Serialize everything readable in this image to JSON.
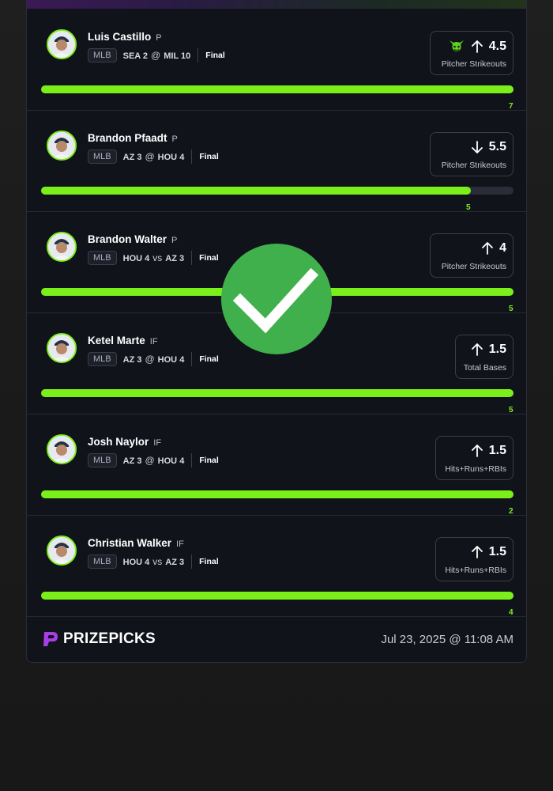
{
  "rows": [
    {
      "name": "Luis Castillo",
      "pos": "P",
      "league": "MLB",
      "team_a": "SEA",
      "score_a": "2",
      "sep": "@",
      "team_b": "MIL",
      "score_b": "10",
      "status": "Final",
      "line": "4.5",
      "direction": "up",
      "stat": "Pitcher Strikeouts",
      "demon": true,
      "actual": "7",
      "progress": 1.0
    },
    {
      "name": "Brandon Pfaadt",
      "pos": "P",
      "league": "MLB",
      "team_a": "AZ",
      "score_a": "3",
      "sep": "@",
      "team_b": "HOU",
      "score_b": "4",
      "status": "Final",
      "line": "5.5",
      "direction": "down",
      "stat": "Pitcher Strikeouts",
      "demon": false,
      "actual": "5",
      "progress": 0.91
    },
    {
      "name": "Brandon Walter",
      "pos": "P",
      "league": "MLB",
      "team_a": "HOU",
      "score_a": "4",
      "sep": "vs",
      "team_b": "AZ",
      "score_b": "3",
      "status": "Final",
      "line": "4",
      "direction": "up",
      "stat": "Pitcher Strikeouts",
      "demon": false,
      "actual": "5",
      "progress": 1.0
    },
    {
      "name": "Ketel Marte",
      "pos": "IF",
      "league": "MLB",
      "team_a": "AZ",
      "score_a": "3",
      "sep": "@",
      "team_b": "HOU",
      "score_b": "4",
      "status": "Final",
      "line": "1.5",
      "direction": "up",
      "stat": "Total Bases",
      "demon": false,
      "actual": "5",
      "progress": 1.0
    },
    {
      "name": "Josh Naylor",
      "pos": "IF",
      "league": "MLB",
      "team_a": "AZ",
      "score_a": "3",
      "sep": "@",
      "team_b": "HOU",
      "score_b": "4",
      "status": "Final",
      "line": "1.5",
      "direction": "up",
      "stat": "Hits+Runs+RBIs",
      "demon": false,
      "actual": "2",
      "progress": 1.0
    },
    {
      "name": "Christian Walker",
      "pos": "IF",
      "league": "MLB",
      "team_a": "HOU",
      "score_a": "4",
      "sep": "vs",
      "team_b": "AZ",
      "score_b": "3",
      "status": "Final",
      "line": "1.5",
      "direction": "up",
      "stat": "Hits+Runs+RBIs",
      "demon": false,
      "actual": "4",
      "progress": 1.0
    }
  ],
  "footer": {
    "brand": "PRIZEPICKS",
    "timestamp": "Jul 23, 2025 @ 11:08 AM"
  },
  "colors": {
    "accent": "#7bef1a",
    "check": "#3fb04b",
    "card": "#11131b"
  },
  "icons": {
    "check": "check-icon",
    "up": "arrow-up-icon",
    "down": "arrow-down-icon",
    "demon": "demon-icon",
    "logo": "prizepicks-logo-icon"
  }
}
